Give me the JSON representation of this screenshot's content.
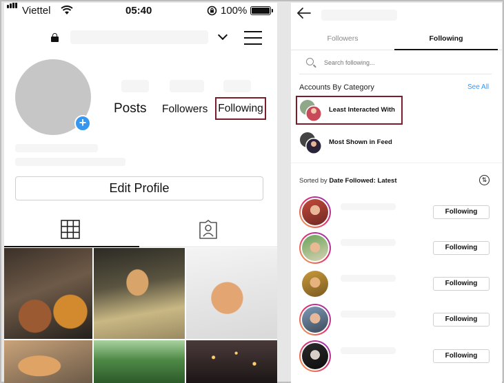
{
  "status_bar": {
    "carrier": "Viettel",
    "time": "05:40",
    "battery": "100%"
  },
  "profile": {
    "stats": {
      "posts": "Posts",
      "followers": "Followers",
      "following": "Following"
    },
    "edit_button": "Edit Profile"
  },
  "following_screen": {
    "tabs": [
      "Followers",
      "Following"
    ],
    "search_placeholder": "Search following...",
    "section_title": "Accounts By Category",
    "see_all": "See All",
    "categories": [
      "Least Interacted With",
      "Most Shown in Feed"
    ],
    "sort_prefix": "Sorted by ",
    "sort_value": "Date Followed: Latest",
    "rows": [
      {
        "button": "Following"
      },
      {
        "button": "Following"
      },
      {
        "button": "Following"
      },
      {
        "button": "Following"
      },
      {
        "button": "Following"
      }
    ]
  },
  "colors": {
    "highlight": "#7b1c2a",
    "link": "#3797f0",
    "badge": "#3797f0"
  },
  "icons": [
    "signal-icon",
    "wifi-icon",
    "rotation-lock-icon",
    "battery-icon",
    "lock-icon",
    "chevron-down-icon",
    "menu-icon",
    "add-icon",
    "grid-icon",
    "tagged-icon",
    "back-arrow-icon",
    "search-icon",
    "sort-icon"
  ]
}
